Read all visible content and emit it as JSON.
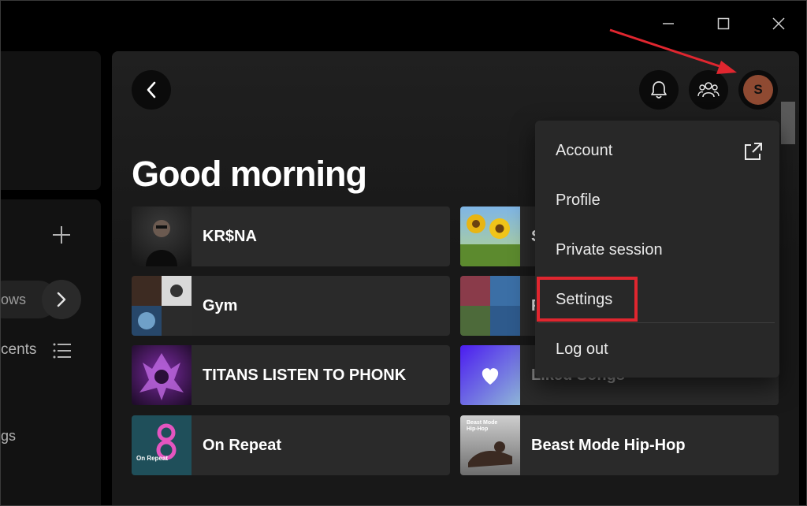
{
  "window": {
    "controls": {
      "minimize_icon": "minimize-icon",
      "maximize_icon": "maximize-icon",
      "close_icon": "close-icon"
    }
  },
  "sidebar": {
    "chip_label": "ows",
    "recents_label": "cents",
    "partial_item": "gs"
  },
  "header": {
    "back_icon": "chevron-left-icon",
    "bell_icon": "bell-icon",
    "friends_icon": "friends-icon",
    "avatar_letter": "S"
  },
  "main": {
    "greeting": "Good morning",
    "tiles": [
      {
        "name": "KR$NA"
      },
      {
        "name": "S"
      },
      {
        "name": "Gym"
      },
      {
        "name": "P"
      },
      {
        "name": "TITANS LISTEN TO PHONK"
      },
      {
        "name": "Liked Songs"
      },
      {
        "name": "On Repeat",
        "art_caption": "On Repeat"
      },
      {
        "name": "Beast Mode Hip-Hop",
        "art_caption": "Beast Mode Hip-Hop"
      }
    ]
  },
  "menu": {
    "items": [
      {
        "label": "Account",
        "icon": "external-link-icon"
      },
      {
        "label": "Profile"
      },
      {
        "label": "Private session"
      },
      {
        "label": "Settings"
      },
      {
        "label": "Log out"
      }
    ]
  },
  "colors": {
    "highlight": "#e0262f",
    "avatar": "#8f4a32",
    "menu_bg": "#282828",
    "tile_bg": "#2a2a2a"
  }
}
